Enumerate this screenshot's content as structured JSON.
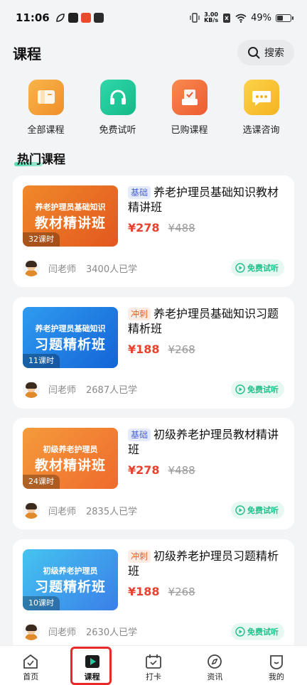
{
  "status_bar": {
    "time": "11:06",
    "net_speed_value": "3.00",
    "net_speed_unit": "KB/s",
    "battery_percent": "49%",
    "battery_level": 0.49
  },
  "header": {
    "title": "课程",
    "search_label": "搜索"
  },
  "entries": [
    {
      "label": "全部课程",
      "icon": "book-icon",
      "color": "#f5a340"
    },
    {
      "label": "免费试听",
      "icon": "headphones-icon",
      "color": "#21c99b"
    },
    {
      "label": "已购课程",
      "icon": "purchased-box-icon",
      "color": "#f2683c"
    },
    {
      "label": "选课咨询",
      "icon": "chat-bubble-icon",
      "color": "#f7c12f"
    }
  ],
  "section": {
    "title": "热门课程"
  },
  "courses": [
    {
      "tag": "基础",
      "tag_type": "basic",
      "name": "养老护理员基础知识教材精讲班",
      "price": "¥278",
      "original_price": "¥488",
      "cover_subtitle": "养老护理员基础知识",
      "cover_title": "教材精讲班",
      "hours": "32课时",
      "cover_colors": [
        "#f0892a",
        "#e2571f"
      ],
      "teacher": "闫老师",
      "learners": "3400人已学",
      "trial_label": "免费试听"
    },
    {
      "tag": "冲刺",
      "tag_type": "sprint",
      "name": "养老护理员基础知识习题精析班",
      "price": "¥188",
      "original_price": "¥268",
      "cover_subtitle": "养老护理员基础知识",
      "cover_title": "习题精析班",
      "hours": "11课时",
      "cover_colors": [
        "#2f9bf0",
        "#1464d6"
      ],
      "teacher": "闫老师",
      "learners": "2687人已学",
      "trial_label": "免费试听"
    },
    {
      "tag": "基础",
      "tag_type": "basic",
      "name": "初级养老护理员教材精讲班",
      "price": "¥278",
      "original_price": "¥488",
      "cover_subtitle": "初级养老护理员",
      "cover_title": "教材精讲班",
      "hours": "24课时",
      "cover_colors": [
        "#f59b3c",
        "#ef6a2c"
      ],
      "teacher": "闫老师",
      "learners": "2835人已学",
      "trial_label": "免费试听"
    },
    {
      "tag": "冲刺",
      "tag_type": "sprint",
      "name": "初级养老护理员习题精析班",
      "price": "¥188",
      "original_price": "¥268",
      "cover_subtitle": "初级养老护理员",
      "cover_title": "习题精析班",
      "hours": "10课时",
      "cover_colors": [
        "#45c4f0",
        "#3a7ee8"
      ],
      "teacher": "闫老师",
      "learners": "2630人已学",
      "trial_label": "免费试听"
    }
  ],
  "bottom_nav": [
    {
      "label": "首页",
      "icon": "home-icon"
    },
    {
      "label": "课程",
      "icon": "course-play-icon",
      "active": true
    },
    {
      "label": "打卡",
      "icon": "calendar-check-icon"
    },
    {
      "label": "资讯",
      "icon": "compass-icon"
    },
    {
      "label": "我的",
      "icon": "profile-icon"
    }
  ],
  "colors": {
    "accent": "#1fbf88",
    "price": "#e8422e",
    "highlight_box": "#e8292a"
  }
}
